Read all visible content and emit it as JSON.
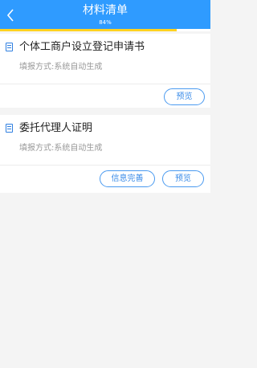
{
  "header": {
    "title": "材料清单",
    "progress_text": "84%",
    "progress_value": 0.84
  },
  "materials": [
    {
      "name": "个体工商户设立登记申请书",
      "fill_method": "填报方式:系统自动生成",
      "buttons": {
        "preview": "预览"
      }
    },
    {
      "name": "委托代理人证明",
      "fill_method": "填报方式:系统自动生成",
      "buttons": {
        "complete_info": "信息完善",
        "preview": "预览"
      }
    }
  ],
  "colors": {
    "header_bg": "#2f9bff",
    "progress_fill": "#ffd21f",
    "accent": "#3a8be8",
    "page_bg": "#f4f4f4"
  },
  "icons": [
    "back-arrow-icon",
    "document-icon"
  ]
}
